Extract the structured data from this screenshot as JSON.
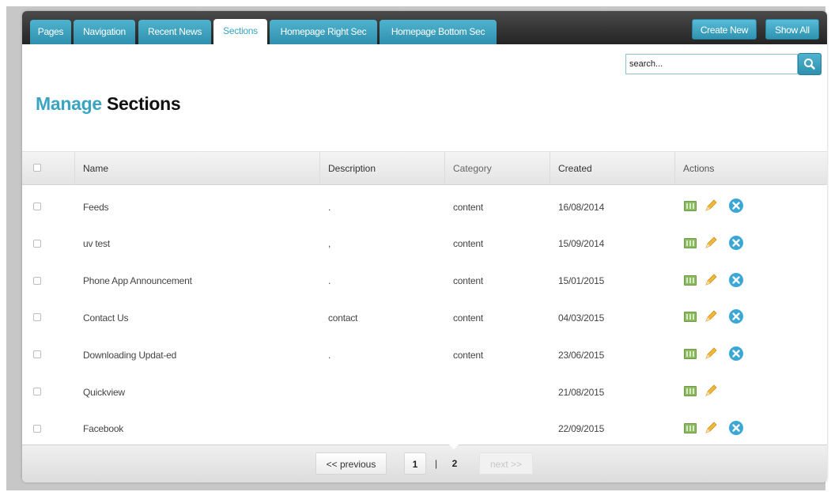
{
  "tabs": [
    {
      "label": "Pages"
    },
    {
      "label": "Navigation"
    },
    {
      "label": "Recent News"
    },
    {
      "label": "Sections",
      "active": true
    },
    {
      "label": "Homepage Right Sec"
    },
    {
      "label": "Homepage Bottom Sec"
    }
  ],
  "toolbar": {
    "create_new_label": "Create New",
    "show_all_label": "Show All"
  },
  "search": {
    "placeholder": "search..."
  },
  "page_title": {
    "highlight": "Manage",
    "rest": "Sections"
  },
  "table": {
    "columns": [
      "Name",
      "Description",
      "Category",
      "Created",
      "Actions"
    ],
    "rows": [
      {
        "name": "Feeds",
        "description": ".",
        "category": "content",
        "created": "16/08/2014",
        "deletable": true
      },
      {
        "name": "uv test",
        "description": ",",
        "category": "content",
        "created": "15/09/2014",
        "deletable": true
      },
      {
        "name": "Phone App Announcement",
        "description": ".",
        "category": "content",
        "created": "15/01/2015",
        "deletable": true
      },
      {
        "name": "Contact Us",
        "description": "contact",
        "category": "content",
        "created": "04/03/2015",
        "deletable": true
      },
      {
        "name": "Downloading Updat-ed",
        "description": ".",
        "category": "content",
        "created": "23/06/2015",
        "deletable": true
      },
      {
        "name": "Quickview",
        "description": "",
        "category": "",
        "created": "21/08/2015",
        "deletable": false
      },
      {
        "name": "Facebook",
        "description": "",
        "category": "",
        "created": "22/09/2015",
        "deletable": true
      }
    ]
  },
  "pagination": {
    "previous_label": "<< previous",
    "pages": [
      "1",
      "2"
    ],
    "current_page": "2",
    "separator": "|",
    "next_label": "next >>"
  },
  "icons": {
    "view": "table-view-icon",
    "edit": "pencil-edit-icon",
    "delete": "delete-x-icon",
    "search": "magnifier-search-icon"
  },
  "colors": {
    "accent": "#3aa4c2",
    "topbar": "#2b2b2b",
    "view_icon": "#8cba61",
    "edit_icon": "#f0b83a",
    "delete_icon": "#3ba7d6"
  }
}
